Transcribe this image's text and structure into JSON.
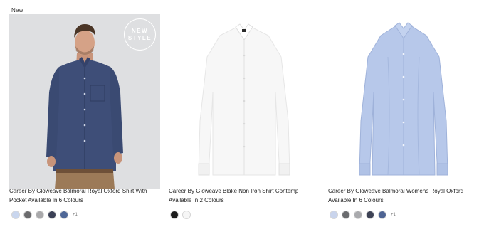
{
  "page": {
    "new_label": "New"
  },
  "products": [
    {
      "title": "Career By Gloweave Balmoral Royal Oxford Shirt With Pocket Available In 6 Colours",
      "badge": {
        "line1": "NEW",
        "line2": "STYLE"
      },
      "swatch_colors": [
        "#c9d6ee",
        "#6b6b6d",
        "#a9a9ab",
        "#3b4156",
        "#4f6797"
      ],
      "more_colors": "+1"
    },
    {
      "title": "Career By Gloweave Blake Non Iron Shirt Contemp Available In 2 Colours",
      "swatch_colors": [
        "#1c1c1c",
        "#f6f6f6"
      ],
      "more_colors": ""
    },
    {
      "title": "Career By Gloweave Balmoral Womens Royal Oxford Available In 6 Colours",
      "swatch_colors": [
        "#c9d4ec",
        "#6a6b6e",
        "#a9aaad",
        "#3d4255",
        "#4e6493"
      ],
      "more_colors": "+1"
    }
  ]
}
